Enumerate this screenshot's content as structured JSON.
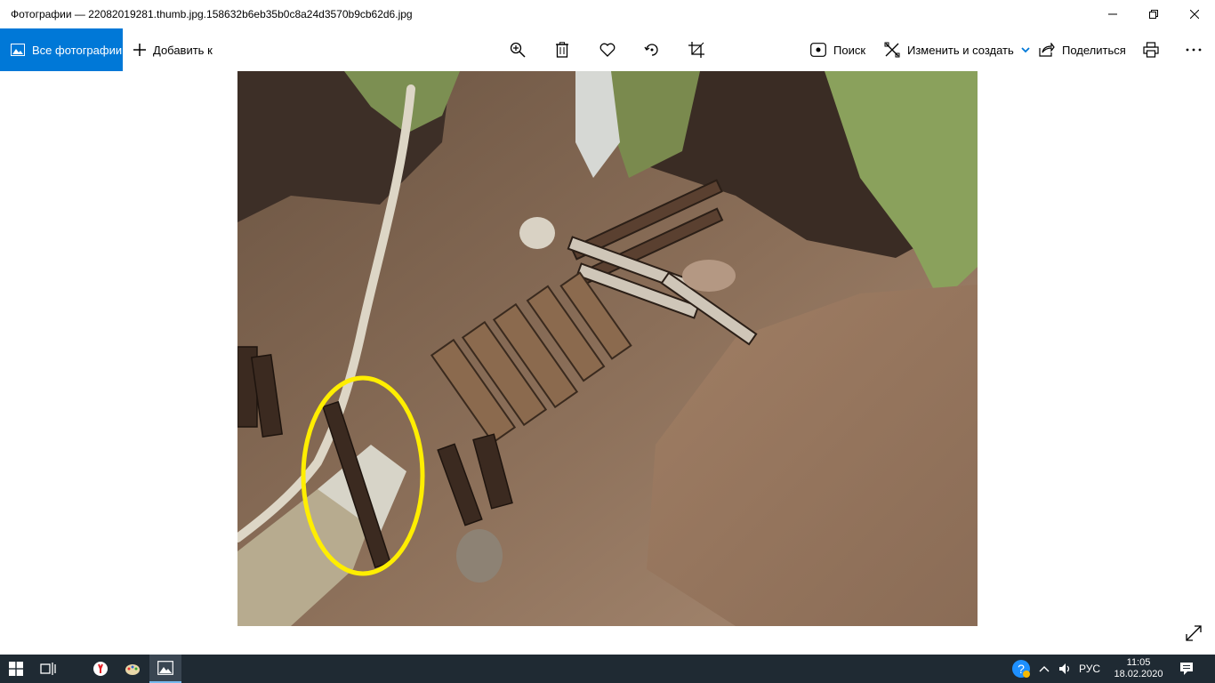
{
  "window": {
    "title": "Фотографии — 22082019281.thumb.jpg.158632b6eb35b0c8a24d3570b9cb62d6.jpg",
    "minimize_icon": "minimize-icon",
    "restore_icon": "restore-icon",
    "close_icon": "close-icon"
  },
  "toolbar": {
    "all_photos_label": "Все фотографии",
    "add_to_label": "Добавить к",
    "zoom_icon": "zoom-in-icon",
    "delete_icon": "trash-icon",
    "favorite_icon": "heart-icon",
    "rotate_icon": "rotate-icon",
    "crop_icon": "crop-icon",
    "search_label": "Поиск",
    "edit_create_label": "Изменить и создать",
    "share_label": "Поделиться",
    "print_icon": "printer-icon",
    "more_icon": "more-icon"
  },
  "colors": {
    "accent": "#0078d7",
    "taskbar": "#1f2a33",
    "highlight_circle": "#ffee00"
  },
  "taskbar": {
    "language": "РУС",
    "time": "11:05",
    "date": "18.02.2020"
  }
}
